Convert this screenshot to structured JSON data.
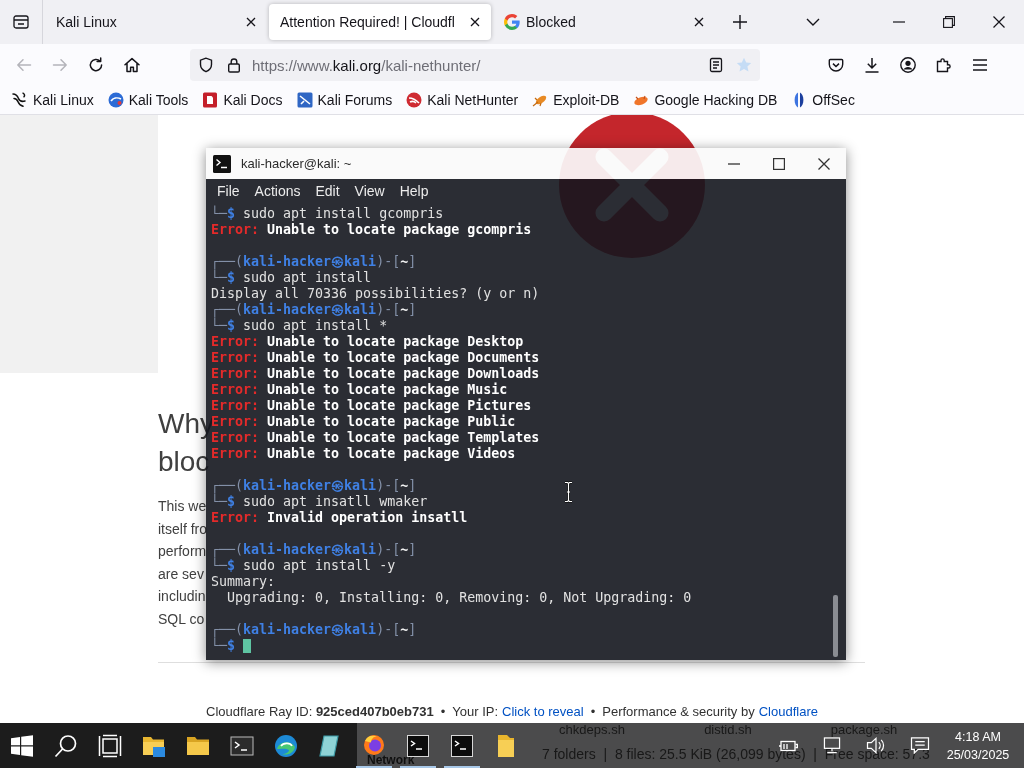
{
  "browser": {
    "tabs": [
      {
        "title": "Kali Linux",
        "selected": false,
        "favicon": false
      },
      {
        "title": "Attention Required! | Cloudfl",
        "selected": true,
        "favicon": false
      },
      {
        "title": "Blocked",
        "selected": false,
        "favicon": true
      }
    ],
    "nav_buttons": [
      {
        "kind": "back",
        "disabled": true
      },
      {
        "kind": "forward",
        "disabled": true
      },
      {
        "kind": "reload",
        "disabled": false
      },
      {
        "kind": "home",
        "disabled": false
      }
    ],
    "address": {
      "prefix": "https://www.",
      "domain": "kali.org",
      "path": "/kali-nethunter/"
    },
    "bookmarks": [
      "Kali Linux",
      "Kali Tools",
      "Kali Docs",
      "Kali Forums",
      "Kali NetHunter",
      "Exploit-DB",
      "Google Hacking DB",
      "OffSec"
    ]
  },
  "page": {
    "left_heading_lines": [
      "Why",
      "bloc"
    ],
    "left_paragraph_lines": [
      "This we",
      "itself fro",
      "perform",
      "are sev",
      "includin",
      "SQL co"
    ],
    "footer": [
      {
        "kind": "text",
        "text": "Cloudflare Ray ID: **925ced407b0eb731**"
      },
      {
        "kind": "separator",
        "text": "•"
      },
      {
        "kind": "text",
        "text": "Your IP:"
      },
      {
        "kind": "link",
        "text": "Click to reveal"
      },
      {
        "kind": "separator",
        "text": "•"
      },
      {
        "kind": "text",
        "text": "Performance & security by"
      },
      {
        "kind": "link",
        "text": "Cloudflare"
      }
    ]
  },
  "terminal": {
    "title": "kali-hacker@kali: ~",
    "menu": [
      "File",
      "Actions",
      "Edit",
      "View",
      "Help"
    ],
    "cursor_visible": true,
    "blocks": [
      {
        "lines": [
          {
            "segments": [
              {
                "kind": "frame",
                "text": "└─"
              },
              {
                "kind": "sigil",
                "text": "$"
              },
              {
                "kind": "plain",
                "text": " sudo apt install gcompris"
              }
            ]
          },
          {
            "segments": [
              {
                "kind": "error",
                "text": "Error:"
              },
              {
                "kind": "strong",
                "text": " Unable to locate package gcompris"
              }
            ]
          }
        ]
      },
      {
        "lines": [
          {
            "segments": [
              {
                "kind": "frame",
                "text": "┌──("
              },
              {
                "kind": "user",
                "text": "kali-hacker㉿kali"
              },
              {
                "kind": "frame",
                "text": ")-["
              },
              {
                "kind": "dir",
                "text": "~"
              },
              {
                "kind": "frame",
                "text": "]"
              }
            ]
          },
          {
            "segments": [
              {
                "kind": "frame",
                "text": "└─"
              },
              {
                "kind": "sigil",
                "text": "$"
              },
              {
                "kind": "plain",
                "text": " sudo apt install"
              }
            ]
          },
          {
            "segments": [
              {
                "kind": "plain",
                "text": "Display all 70336 possibilities? (y or n)"
              }
            ]
          },
          {
            "segments": [
              {
                "kind": "frame",
                "text": "┌──("
              },
              {
                "kind": "user",
                "text": "kali-hacker㉿kali"
              },
              {
                "kind": "frame",
                "text": ")-["
              },
              {
                "kind": "dir",
                "text": "~"
              },
              {
                "kind": "frame",
                "text": "]"
              }
            ]
          },
          {
            "segments": [
              {
                "kind": "frame",
                "text": "└─"
              },
              {
                "kind": "sigil",
                "text": "$"
              },
              {
                "kind": "plain",
                "text": " sudo apt install *"
              }
            ]
          },
          {
            "segments": [
              {
                "kind": "error",
                "text": "Error:"
              },
              {
                "kind": "strong",
                "text": " Unable to locate package Desktop"
              }
            ]
          },
          {
            "segments": [
              {
                "kind": "error",
                "text": "Error:"
              },
              {
                "kind": "strong",
                "text": " Unable to locate package Documents"
              }
            ]
          },
          {
            "segments": [
              {
                "kind": "error",
                "text": "Error:"
              },
              {
                "kind": "strong",
                "text": " Unable to locate package Downloads"
              }
            ]
          },
          {
            "segments": [
              {
                "kind": "error",
                "text": "Error:"
              },
              {
                "kind": "strong",
                "text": " Unable to locate package Music"
              }
            ]
          },
          {
            "segments": [
              {
                "kind": "error",
                "text": "Error:"
              },
              {
                "kind": "strong",
                "text": " Unable to locate package Pictures"
              }
            ]
          },
          {
            "segments": [
              {
                "kind": "error",
                "text": "Error:"
              },
              {
                "kind": "strong",
                "text": " Unable to locate package Public"
              }
            ]
          },
          {
            "segments": [
              {
                "kind": "error",
                "text": "Error:"
              },
              {
                "kind": "strong",
                "text": " Unable to locate package Templates"
              }
            ]
          },
          {
            "segments": [
              {
                "kind": "error",
                "text": "Error:"
              },
              {
                "kind": "strong",
                "text": " Unable to locate package Videos"
              }
            ]
          }
        ]
      },
      {
        "lines": [
          {
            "segments": [
              {
                "kind": "frame",
                "text": "┌──("
              },
              {
                "kind": "user",
                "text": "kali-hacker㉿kali"
              },
              {
                "kind": "frame",
                "text": ")-["
              },
              {
                "kind": "dir",
                "text": "~"
              },
              {
                "kind": "frame",
                "text": "]"
              }
            ]
          },
          {
            "segments": [
              {
                "kind": "frame",
                "text": "└─"
              },
              {
                "kind": "sigil",
                "text": "$"
              },
              {
                "kind": "plain",
                "text": " sudo apt insatll wmaker"
              }
            ]
          },
          {
            "segments": [
              {
                "kind": "error",
                "text": "Error:"
              },
              {
                "kind": "strong",
                "text": " Invalid operation insatll"
              }
            ]
          }
        ]
      },
      {
        "lines": [
          {
            "segments": [
              {
                "kind": "frame",
                "text": "┌──("
              },
              {
                "kind": "user",
                "text": "kali-hacker㉿kali"
              },
              {
                "kind": "frame",
                "text": ")-["
              },
              {
                "kind": "dir",
                "text": "~"
              },
              {
                "kind": "frame",
                "text": "]"
              }
            ]
          },
          {
            "segments": [
              {
                "kind": "frame",
                "text": "└─"
              },
              {
                "kind": "sigil",
                "text": "$"
              },
              {
                "kind": "plain",
                "text": " sudo apt install -y"
              }
            ]
          },
          {
            "segments": [
              {
                "kind": "plain",
                "text": "Summary:"
              }
            ]
          },
          {
            "segments": [
              {
                "kind": "plain",
                "text": "  Upgrading: 0, Installing: 0, Removing: 0, Not Upgrading: 0"
              }
            ]
          }
        ]
      },
      {
        "lines": [
          {
            "segments": [
              {
                "kind": "frame",
                "text": "┌──("
              },
              {
                "kind": "user",
                "text": "kali-hacker㉿kali"
              },
              {
                "kind": "frame",
                "text": ")-["
              },
              {
                "kind": "dir",
                "text": "~"
              },
              {
                "kind": "frame",
                "text": "]"
              }
            ]
          },
          {
            "segments": [
              {
                "kind": "frame",
                "text": "└─"
              },
              {
                "kind": "sigil",
                "text": "$"
              }
            ]
          }
        ]
      }
    ]
  },
  "taskbar": {
    "apps": [
      {
        "running": false
      },
      {
        "running": false
      },
      {
        "running": false
      },
      {
        "running": false
      },
      {
        "running": false
      },
      {
        "running": false
      },
      {
        "running": false
      },
      {
        "running": false
      },
      {
        "running": true
      },
      {
        "running": true
      },
      {
        "running": true
      },
      {
        "running": false
      }
    ],
    "file_manager": {
      "files": [
        "chkdeps.sh",
        "distid.sh",
        "package.sh"
      ],
      "places": [
        "Network"
      ],
      "status": "7 folders  |  8 files: 25.5 KiB (26,099 bytes)  |  Free space: 57.3"
    },
    "clock": {
      "time": "4:18 AM",
      "date": "25/03/2025"
    }
  }
}
